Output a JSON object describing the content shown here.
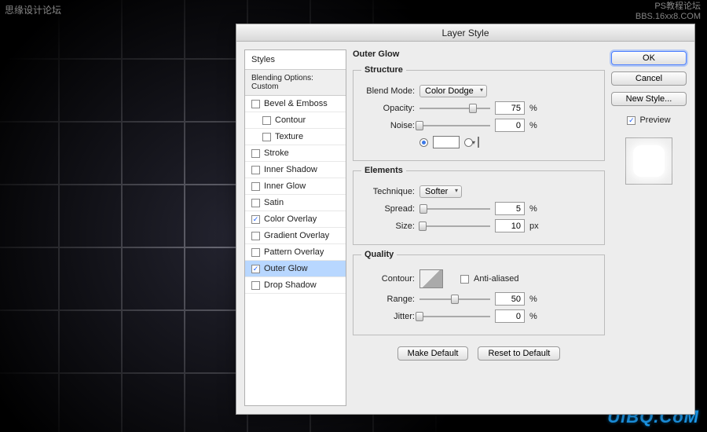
{
  "watermarks": {
    "top_left": "思缘设计论坛",
    "top_right_1": "PS教程论坛",
    "top_right_2": "BBS.16xx8.COM",
    "bottom_right": "UiBQ.CoM"
  },
  "dialog": {
    "title": "Layer Style"
  },
  "styles": {
    "header": "Styles",
    "blending": "Blending Options: Custom",
    "items": [
      {
        "label": "Bevel & Emboss",
        "indent": false,
        "checked": false,
        "selected": false
      },
      {
        "label": "Contour",
        "indent": true,
        "checked": false,
        "selected": false
      },
      {
        "label": "Texture",
        "indent": true,
        "checked": false,
        "selected": false
      },
      {
        "label": "Stroke",
        "indent": false,
        "checked": false,
        "selected": false
      },
      {
        "label": "Inner Shadow",
        "indent": false,
        "checked": false,
        "selected": false
      },
      {
        "label": "Inner Glow",
        "indent": false,
        "checked": false,
        "selected": false
      },
      {
        "label": "Satin",
        "indent": false,
        "checked": false,
        "selected": false
      },
      {
        "label": "Color Overlay",
        "indent": false,
        "checked": true,
        "selected": false
      },
      {
        "label": "Gradient Overlay",
        "indent": false,
        "checked": false,
        "selected": false
      },
      {
        "label": "Pattern Overlay",
        "indent": false,
        "checked": false,
        "selected": false
      },
      {
        "label": "Outer Glow",
        "indent": false,
        "checked": true,
        "selected": true
      },
      {
        "label": "Drop Shadow",
        "indent": false,
        "checked": false,
        "selected": false
      }
    ]
  },
  "panel": {
    "title": "Outer Glow",
    "structure": {
      "legend": "Structure",
      "blend_mode_label": "Blend Mode:",
      "blend_mode_value": "Color Dodge",
      "opacity_label": "Opacity:",
      "opacity_value": "75",
      "opacity_unit": "%",
      "noise_label": "Noise:",
      "noise_value": "0",
      "noise_unit": "%"
    },
    "elements": {
      "legend": "Elements",
      "technique_label": "Technique:",
      "technique_value": "Softer",
      "spread_label": "Spread:",
      "spread_value": "5",
      "spread_unit": "%",
      "size_label": "Size:",
      "size_value": "10",
      "size_unit": "px"
    },
    "quality": {
      "legend": "Quality",
      "contour_label": "Contour:",
      "anti_aliased_label": "Anti-aliased",
      "range_label": "Range:",
      "range_value": "50",
      "range_unit": "%",
      "jitter_label": "Jitter:",
      "jitter_value": "0",
      "jitter_unit": "%"
    },
    "buttons": {
      "make_default": "Make Default",
      "reset_default": "Reset to Default"
    }
  },
  "actions": {
    "ok": "OK",
    "cancel": "Cancel",
    "new_style": "New Style...",
    "preview": "Preview"
  }
}
